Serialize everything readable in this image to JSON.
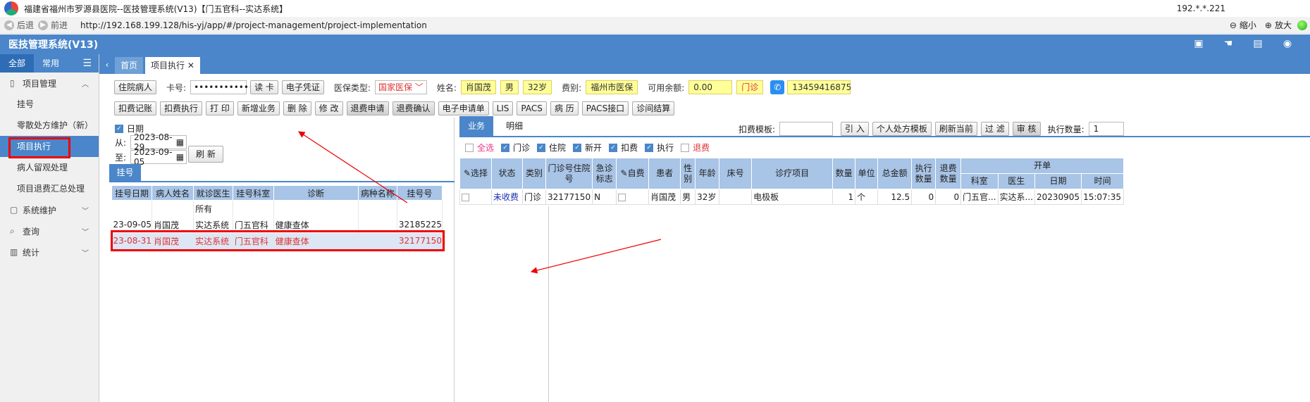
{
  "window": {
    "title": "福建省福州市罗源县医院--医技管理系统(V13)【门五官科--实达系统】",
    "ip": "192.*.*.221"
  },
  "browser": {
    "back": "后退",
    "forward": "前进",
    "url": "http://192.168.199.128/his-yj/app/#/project-management/project-implementation",
    "zoom_out": "缩小",
    "zoom_in": "放大"
  },
  "app": {
    "title": "医技管理系统(V13)"
  },
  "sidebar": {
    "tabs": [
      "全部",
      "常用"
    ],
    "groups": [
      {
        "label": "项目管理",
        "items": [
          "挂号",
          "零散处方维护（新）",
          "项目执行",
          "病人留观处理",
          "项目退费汇总处理"
        ]
      },
      {
        "label": "系统维护"
      },
      {
        "label": "查询"
      },
      {
        "label": "统计"
      }
    ]
  },
  "page_tabs": [
    "首页",
    "项目执行"
  ],
  "patient": {
    "inpatient_btn": "住院病人",
    "card_label": "卡号:",
    "card_value": "••••••••••••••",
    "read_card_btn": "读 卡",
    "e_cert_btn": "电子凭证",
    "ins_type_label": "医保类型:",
    "ins_type_value": "国家医保",
    "name_label": "姓名:",
    "name": "肖国茂",
    "sex": "男",
    "age": "32岁",
    "fee_label": "费别:",
    "fee_value": "福州市医保",
    "balance_label": "可用余额:",
    "balance": "0.00",
    "visit_type": "门诊",
    "phone": "13459416875"
  },
  "actions": [
    "扣费记账",
    "扣费执行",
    "打 印",
    "新增业务",
    "删 除",
    "修 改",
    "退费申请",
    "退费确认",
    "电子申请单",
    "LIS",
    "PACS",
    "病 历",
    "PACS接口",
    "诊间结算"
  ],
  "left": {
    "date_label": "日期",
    "from_label": "从:",
    "from": "2023-08-29",
    "to_label": "至:",
    "to": "2023-09-05",
    "refresh": "刷 新",
    "tab": "挂号",
    "columns": [
      "挂号日期",
      "病人姓名",
      "就诊医生",
      "挂号科室",
      "诊断",
      "病种名称",
      "挂号号"
    ],
    "rows": [
      [
        "",
        "",
        "所有",
        "",
        "",
        "",
        ""
      ],
      [
        "23-09-05",
        "肖国茂",
        "实达系统",
        "门五官科",
        "健康查体",
        "",
        "32185225"
      ],
      [
        "23-08-31",
        "肖国茂",
        "实达系统",
        "门五官科",
        "健康查体",
        "",
        "32177150"
      ]
    ]
  },
  "right": {
    "tabs": [
      "业务",
      "明细"
    ],
    "template_label": "扣费模板:",
    "buttons": [
      "引 入",
      "个人处方模板",
      "刷新当前",
      "过 滤",
      "审 核"
    ],
    "exec_qty_label": "执行数量:",
    "exec_qty": "1",
    "filters": [
      {
        "label": "全选",
        "checked": false
      },
      {
        "label": "门诊",
        "checked": true
      },
      {
        "label": "住院",
        "checked": true
      },
      {
        "label": "新开",
        "checked": true
      },
      {
        "label": "扣费",
        "checked": true
      },
      {
        "label": "执行",
        "checked": true
      },
      {
        "label": "退费",
        "checked": false
      }
    ],
    "header_group": "开单",
    "columns": [
      "选择",
      "状态",
      "类别",
      "门诊号住院号",
      "急诊标志",
      "自费",
      "患者",
      "性别",
      "年龄",
      "床号",
      "诊疗项目",
      "数量",
      "单位",
      "总金额",
      "执行数量",
      "退费数量",
      "科室",
      "医生",
      "日期",
      "时间"
    ],
    "rows": [
      [
        "",
        "未收费",
        "门诊",
        "32177150",
        "N",
        "",
        "肖国茂",
        "男",
        "32岁",
        "",
        "电极板",
        "1",
        "个",
        "12.5",
        "0",
        "0",
        "门五官...",
        "实达系...",
        "20230905",
        "15:07:35"
      ]
    ]
  }
}
